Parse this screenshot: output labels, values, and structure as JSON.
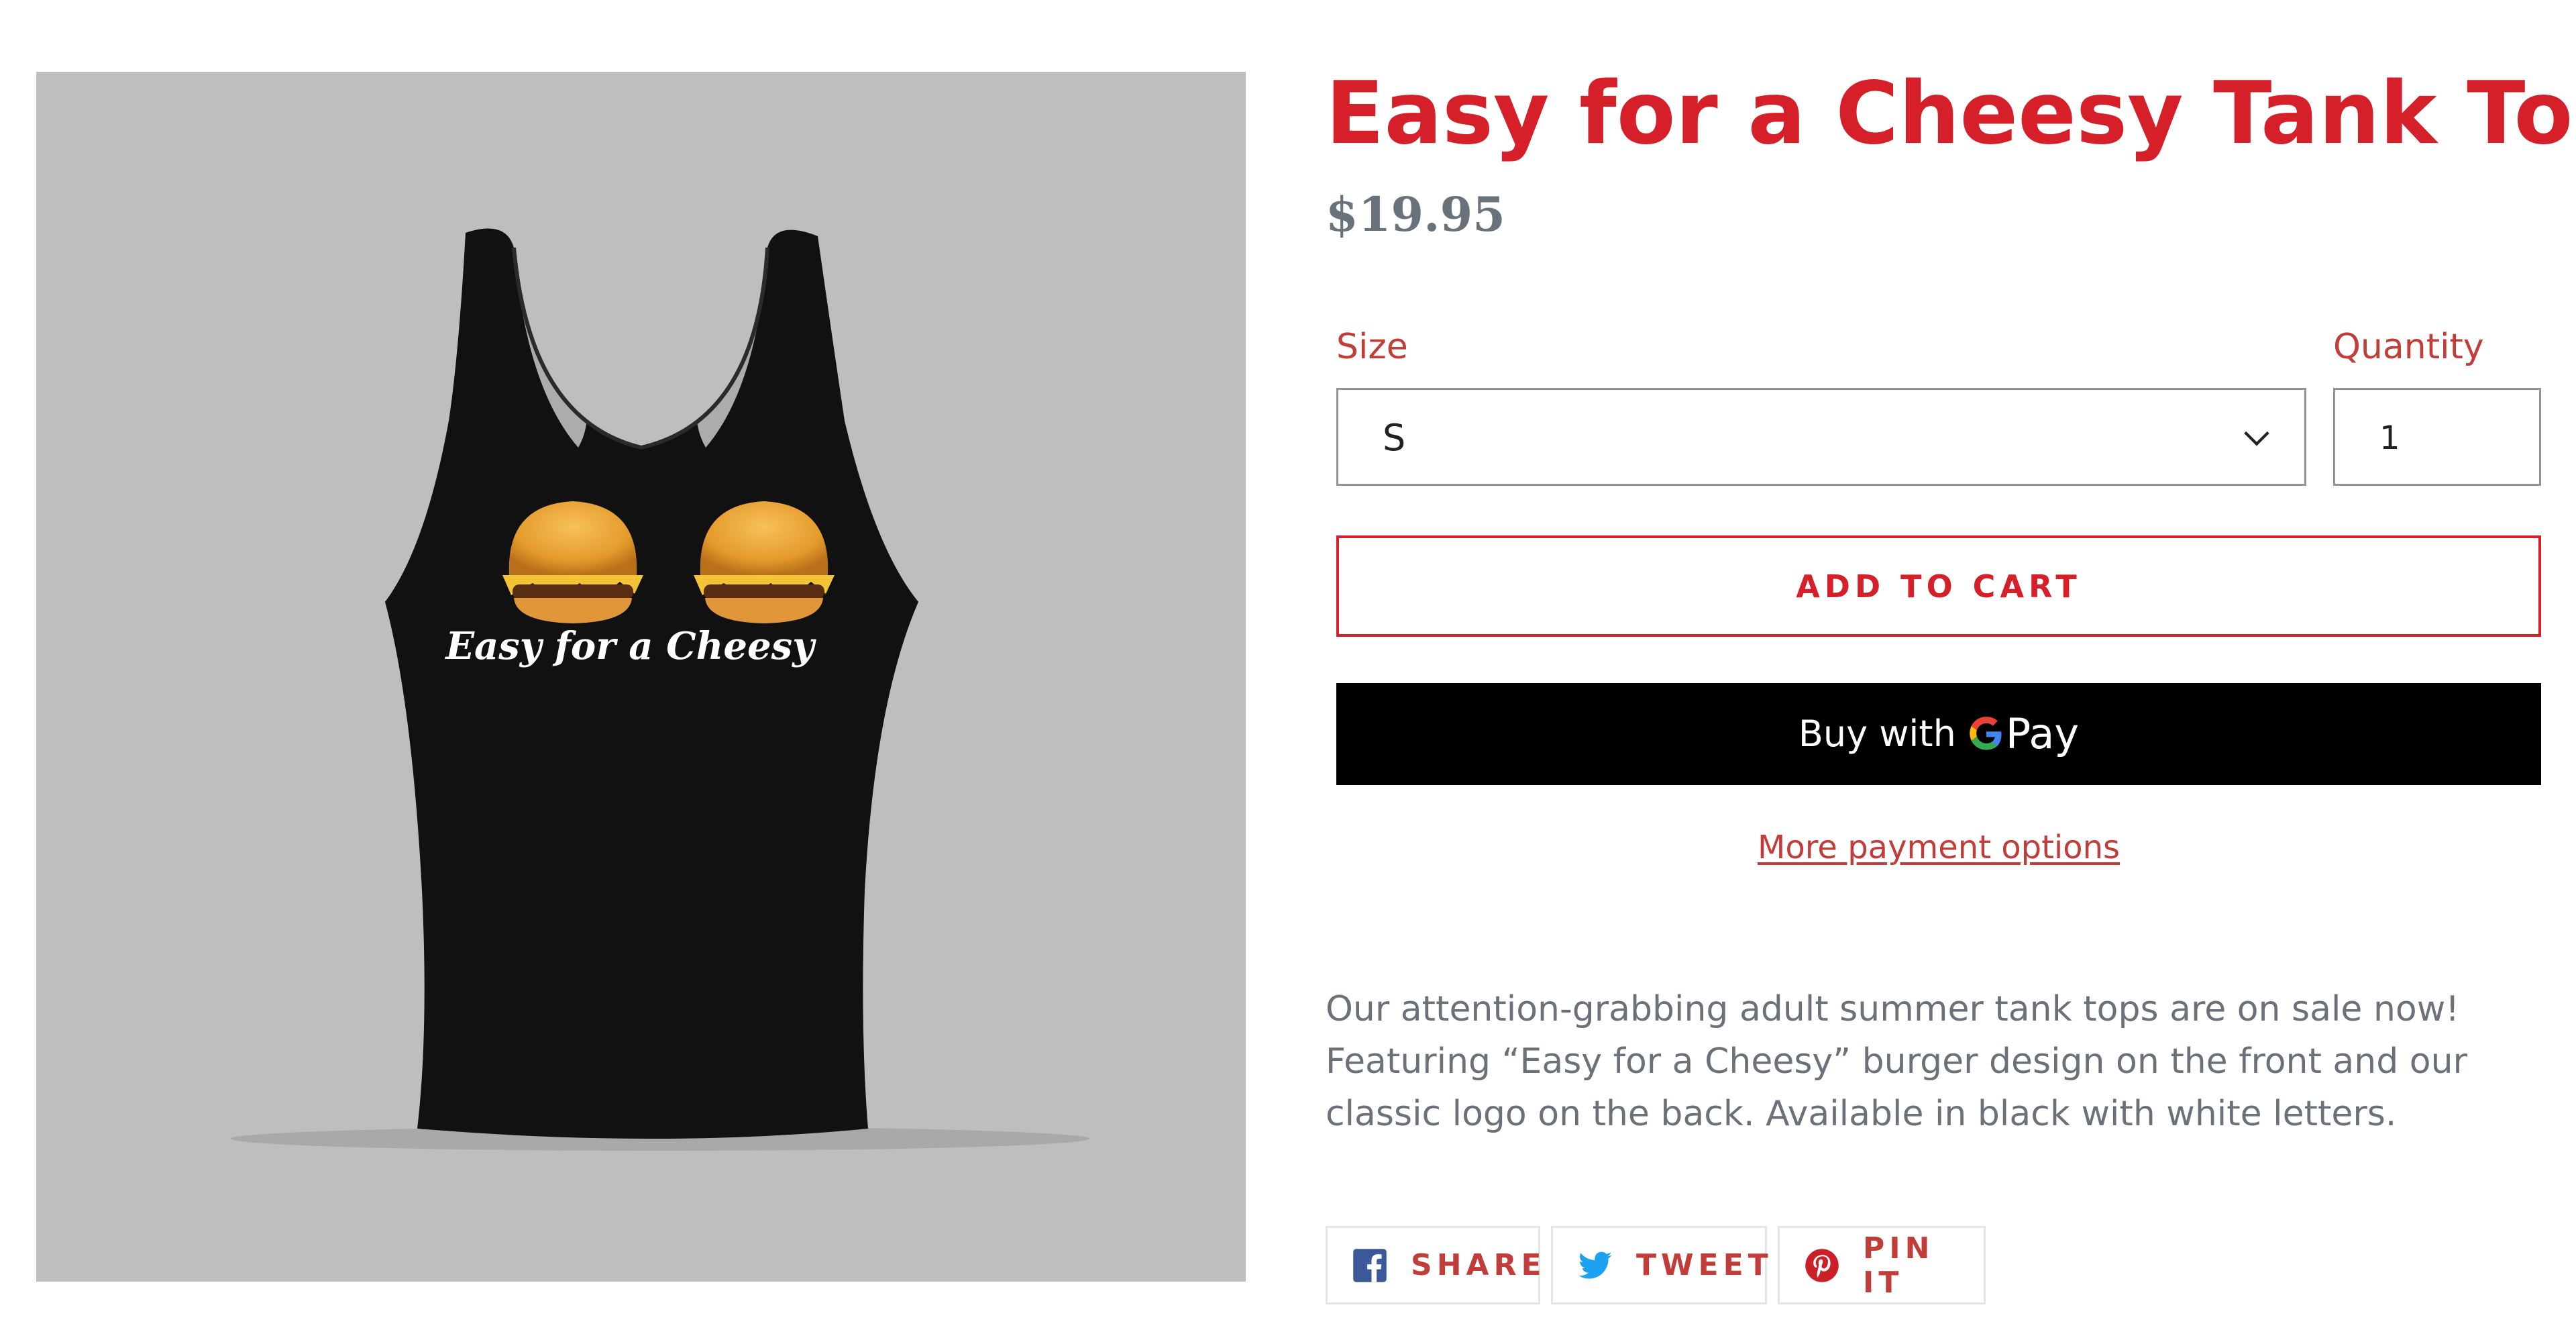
{
  "product": {
    "title": "Easy for a Cheesy Tank Top",
    "price": "$19.95",
    "image_text": "Easy for a Cheesy",
    "description": "Our attention-grabbing adult summer tank tops are on sale now! Featuring “Easy for a Cheesy” burger design on the front and our classic logo on the back. Available in black with white letters."
  },
  "options": {
    "size_label": "Size",
    "size_value": "S",
    "quantity_label": "Quantity",
    "quantity_value": "1"
  },
  "actions": {
    "add_to_cart": "ADD TO CART",
    "gpay_prefix": "Buy with",
    "gpay_word": "Pay",
    "more_payment": "More payment options"
  },
  "share": {
    "facebook": "SHARE",
    "twitter": "TWEET",
    "pinterest": "PIN IT"
  },
  "colors": {
    "accent": "#d5202a",
    "link": "#c13d3a",
    "price": "#69727b",
    "image_bg": "#bebebe",
    "facebook": "#3b5998",
    "twitter": "#1da1f2",
    "pinterest": "#cb2027"
  },
  "icons": [
    "chevron-down-icon",
    "google-g-icon",
    "facebook-icon",
    "twitter-icon",
    "pinterest-icon"
  ]
}
